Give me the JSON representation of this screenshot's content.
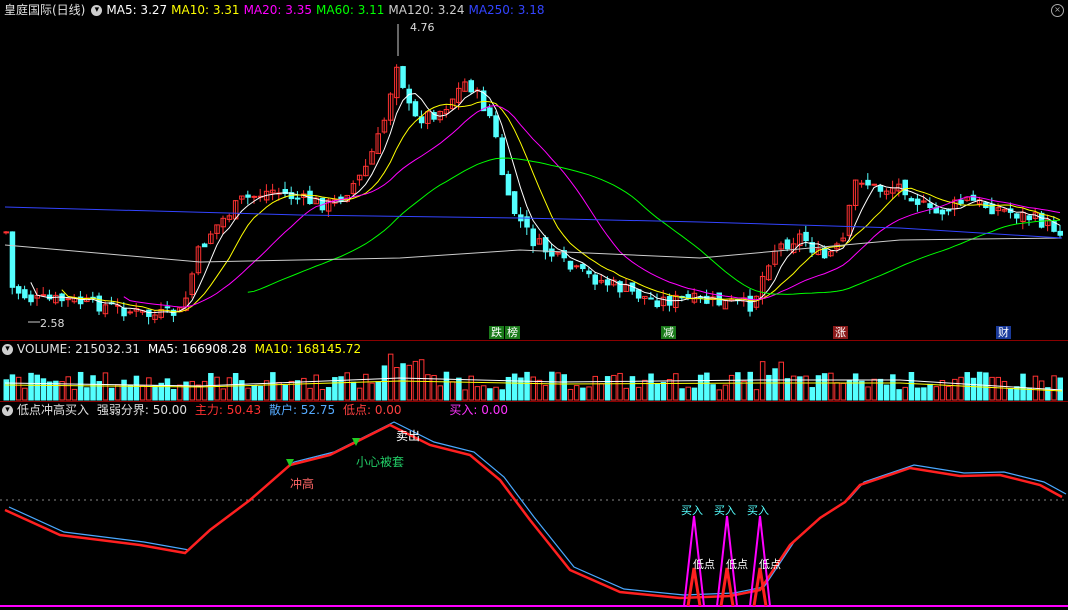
{
  "price_panel": {
    "title": "皇庭国际(日线)",
    "ma": [
      {
        "label": "MA5: 3.27",
        "color": "#ffffff"
      },
      {
        "label": "MA10: 3.31",
        "color": "#ffff00"
      },
      {
        "label": "MA20: 3.35",
        "color": "#ff00ff"
      },
      {
        "label": "MA60: 3.11",
        "color": "#00ff00"
      },
      {
        "label": "MA120: 3.24",
        "color": "#cccccc"
      },
      {
        "label": "MA250: 3.18",
        "color": "#3344ff"
      }
    ],
    "high_label": "4.76",
    "low_label": "2.58",
    "badges": [
      {
        "text": "跌",
        "bg": "#1a7a1a",
        "fg": "#ffffff"
      },
      {
        "text": "榜",
        "bg": "#1a7a1a",
        "fg": "#ffffff"
      },
      {
        "text": "减",
        "bg": "#1a7a1a",
        "fg": "#ffffff"
      },
      {
        "text": "涨",
        "bg": "#8a1a1a",
        "fg": "#ffffff"
      },
      {
        "text": "财",
        "bg": "#1a3a9a",
        "fg": "#ffffff"
      }
    ]
  },
  "volume_panel": {
    "title": "VOLUME: 215032.31",
    "ma5": "MA5: 166908.28",
    "ma10": "MA10: 168145.72"
  },
  "indicator_panel": {
    "title": "低点冲高买入",
    "boundary": "强弱分界: 50.00",
    "main": "主力: 50.43",
    "retail": "散户: 52.75",
    "low": "低点: 0.00",
    "buy": "买入: 0.00",
    "annotations": {
      "rush_high": "冲高",
      "careful": "小心被套",
      "sell": "卖出",
      "buy": "买入",
      "low_point": "低点"
    }
  },
  "colors": {
    "up": "#ff3232",
    "down": "#54ffff",
    "main_line": "#ff2020",
    "retail_line": "#4aa8ff",
    "buy_line": "#ff00ff"
  }
}
